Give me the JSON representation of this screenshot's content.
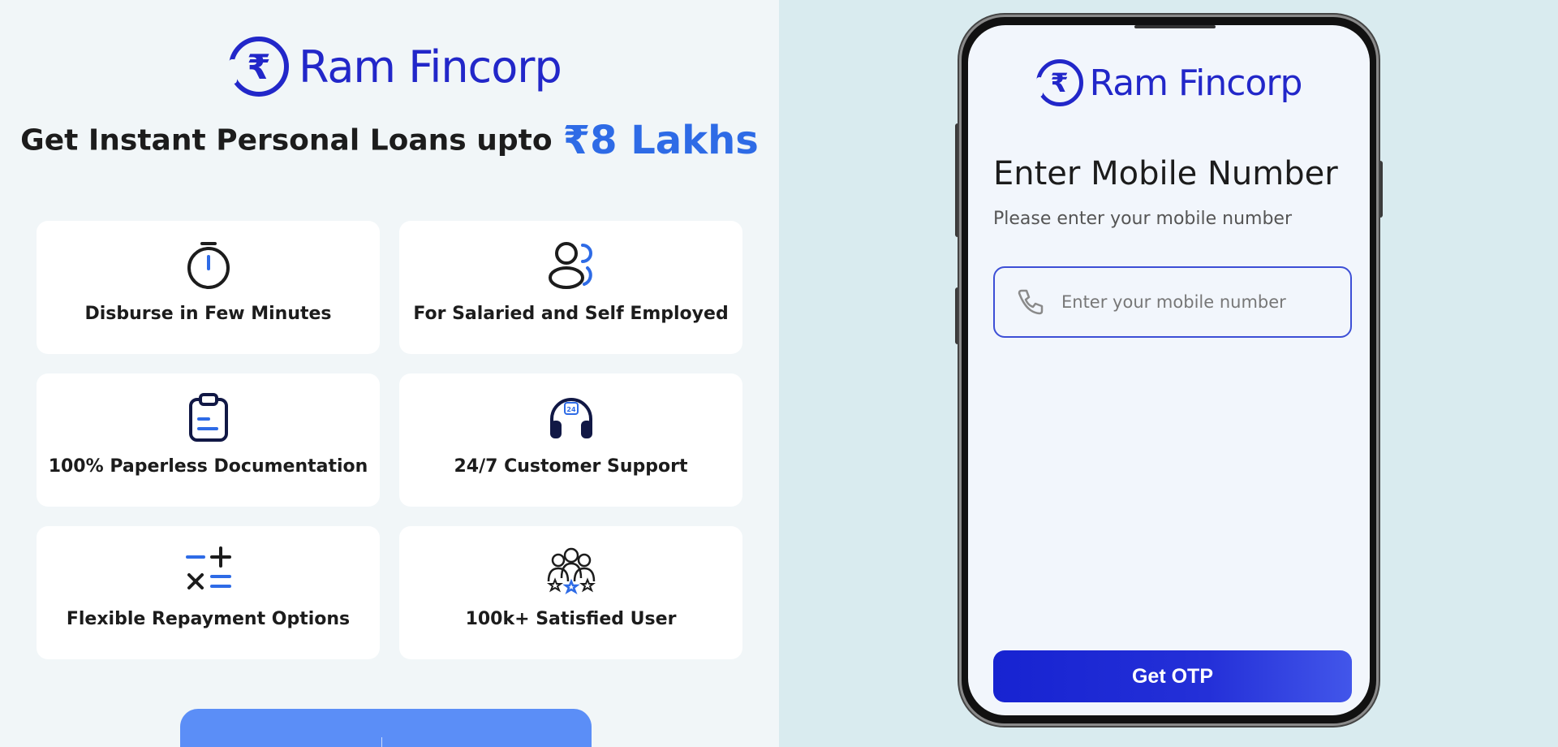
{
  "brand": {
    "name": "Ram Fincorp",
    "symbol": "₹"
  },
  "headline": {
    "prefix": "Get Instant Personal Loans upto",
    "amount": "₹8 Lakhs"
  },
  "features": [
    {
      "icon": "stopwatch-icon",
      "label": "Disburse in Few Minutes"
    },
    {
      "icon": "users-icon",
      "label": "For Salaried and Self Employed"
    },
    {
      "icon": "clipboard-icon",
      "label": "100% Paperless Documentation"
    },
    {
      "icon": "headset-24-icon",
      "label": "24/7 Customer Support"
    },
    {
      "icon": "calculator-icon",
      "label": "Flexible Repayment Options"
    },
    {
      "icon": "group-stars-icon",
      "label": "100k+ Satisfied User"
    }
  ],
  "login": {
    "title": "Enter Mobile Number",
    "subtitle": "Please enter your mobile number",
    "mobile_placeholder": "Enter your mobile number",
    "mobile_value": "",
    "submit_label": "Get OTP"
  },
  "colors": {
    "brand": "#2227c9",
    "accent": "#2e6be6",
    "button": "#1723d1"
  }
}
